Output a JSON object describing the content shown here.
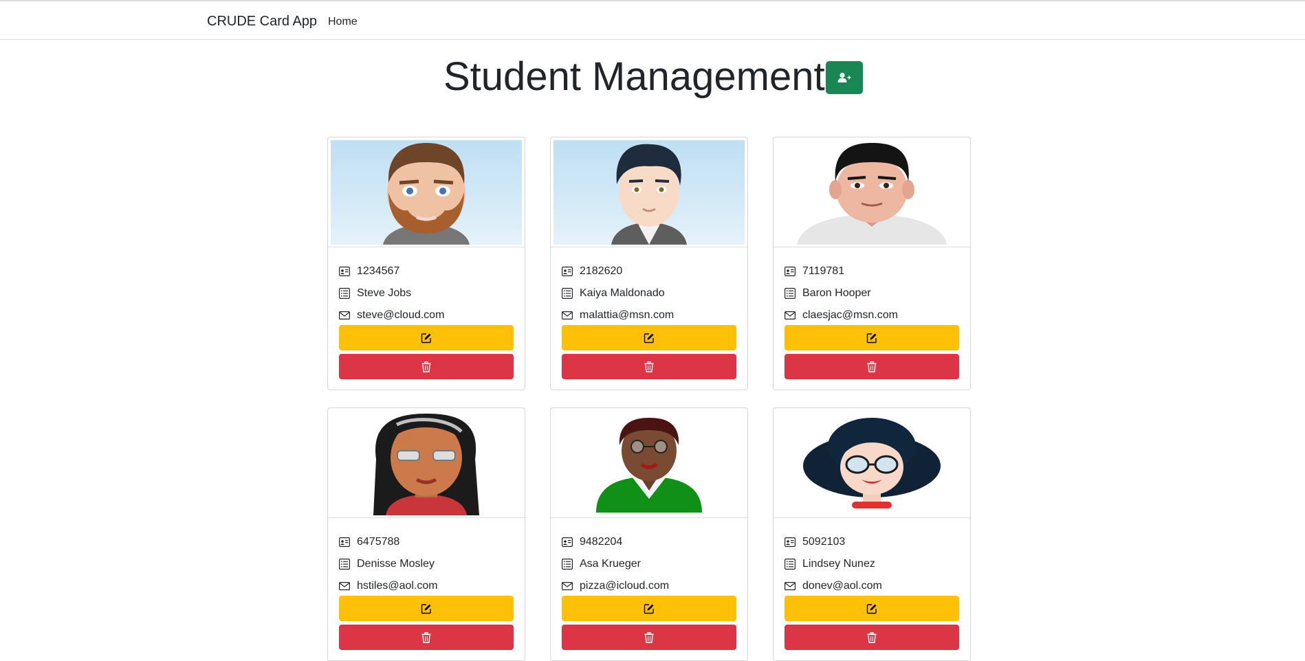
{
  "nav": {
    "brand": "CRUDE Card App",
    "home": "Home"
  },
  "page": {
    "title": "Student Management"
  },
  "colors": {
    "success": "#198754",
    "warning": "#ffc107",
    "danger": "#dc3545"
  },
  "students": [
    {
      "id": "1234567",
      "name": "Steve Jobs",
      "email": "steve@cloud.com"
    },
    {
      "id": "2182620",
      "name": "Kaiya Maldonado",
      "email": "malattia@msn.com"
    },
    {
      "id": "7119781",
      "name": "Baron Hooper",
      "email": "claesjac@msn.com"
    },
    {
      "id": "6475788",
      "name": "Denisse Mosley",
      "email": "hstiles@aol.com"
    },
    {
      "id": "9482204",
      "name": "Asa Krueger",
      "email": "pizza@icloud.com"
    },
    {
      "id": "5092103",
      "name": "Lindsey Nunez",
      "email": "donev@aol.com"
    }
  ],
  "icons": {
    "add": "person-plus-icon",
    "id": "id-card-icon",
    "name": "list-icon",
    "email": "envelope-icon",
    "edit": "pencil-square-icon",
    "delete": "trash-icon"
  }
}
